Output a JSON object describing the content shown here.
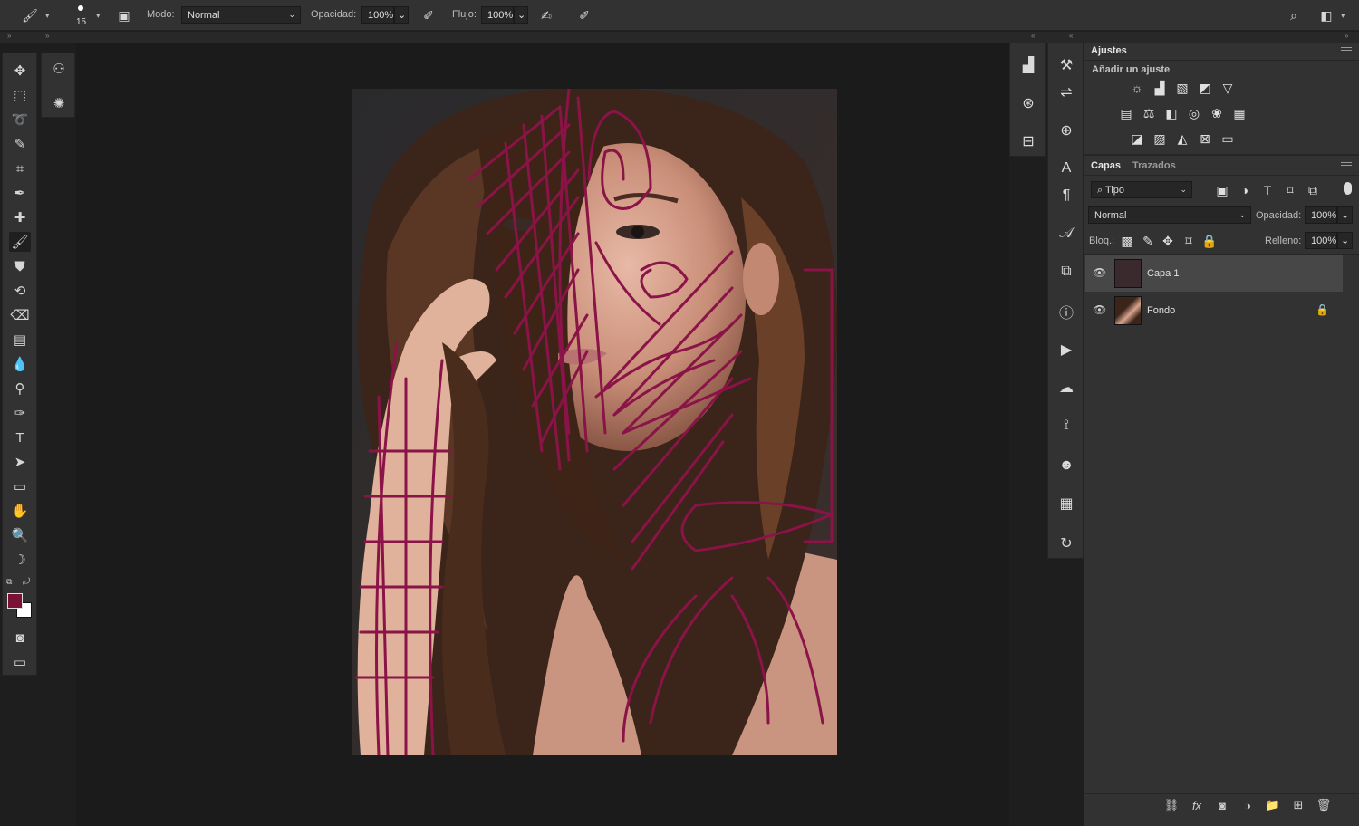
{
  "options_bar": {
    "brush_size": "15",
    "mode_label": "Modo:",
    "mode_value": "Normal",
    "opacity_label": "Opacidad:",
    "opacity_value": "100%",
    "flow_label": "Flujo:",
    "flow_value": "100%"
  },
  "tools": [
    {
      "name": "move-tool",
      "glyph": "✥"
    },
    {
      "name": "marquee-tool",
      "glyph": "⬚"
    },
    {
      "name": "lasso-tool",
      "glyph": "➰"
    },
    {
      "name": "quick-selection-tool",
      "glyph": "✎"
    },
    {
      "name": "crop-tool",
      "glyph": "⌗"
    },
    {
      "name": "eyedropper-tool",
      "glyph": "✒"
    },
    {
      "name": "healing-brush-tool",
      "glyph": "✚"
    },
    {
      "name": "brush-tool",
      "glyph": "🖌"
    },
    {
      "name": "stamp-tool",
      "glyph": "⛊"
    },
    {
      "name": "history-brush-tool",
      "glyph": "⟲"
    },
    {
      "name": "eraser-tool",
      "glyph": "⌫"
    },
    {
      "name": "gradient-tool",
      "glyph": "▤"
    },
    {
      "name": "blur-tool",
      "glyph": "💧"
    },
    {
      "name": "dodge-tool",
      "glyph": "⚲"
    },
    {
      "name": "pen-tool",
      "glyph": "✑"
    },
    {
      "name": "type-tool",
      "glyph": "T"
    },
    {
      "name": "path-selection-tool",
      "glyph": "➤"
    },
    {
      "name": "rectangle-tool",
      "glyph": "▭"
    },
    {
      "name": "hand-tool",
      "glyph": "✋"
    },
    {
      "name": "zoom-tool",
      "glyph": "🔍"
    },
    {
      "name": "banana-tool",
      "glyph": "☽"
    }
  ],
  "colors": {
    "foreground": "#7a1236",
    "background": "#ffffff",
    "stroke": "#8a1347",
    "panel": "#323232",
    "canvas": "#1b1b1b"
  },
  "adjustments": {
    "title": "Ajustes",
    "subtitle": "Añadir un ajuste"
  },
  "layers_panel": {
    "tab_layers": "Capas",
    "tab_paths": "Trazados",
    "filter_value": "Tipo",
    "blend_mode": "Normal",
    "opacity_label": "Opacidad:",
    "opacity_value": "100%",
    "lock_label": "Bloq.:",
    "fill_label": "Relleno:",
    "fill_value": "100%",
    "layers": [
      {
        "name": "Capa 1",
        "selected": true,
        "locked": false
      },
      {
        "name": "Fondo",
        "selected": false,
        "locked": true
      }
    ]
  }
}
